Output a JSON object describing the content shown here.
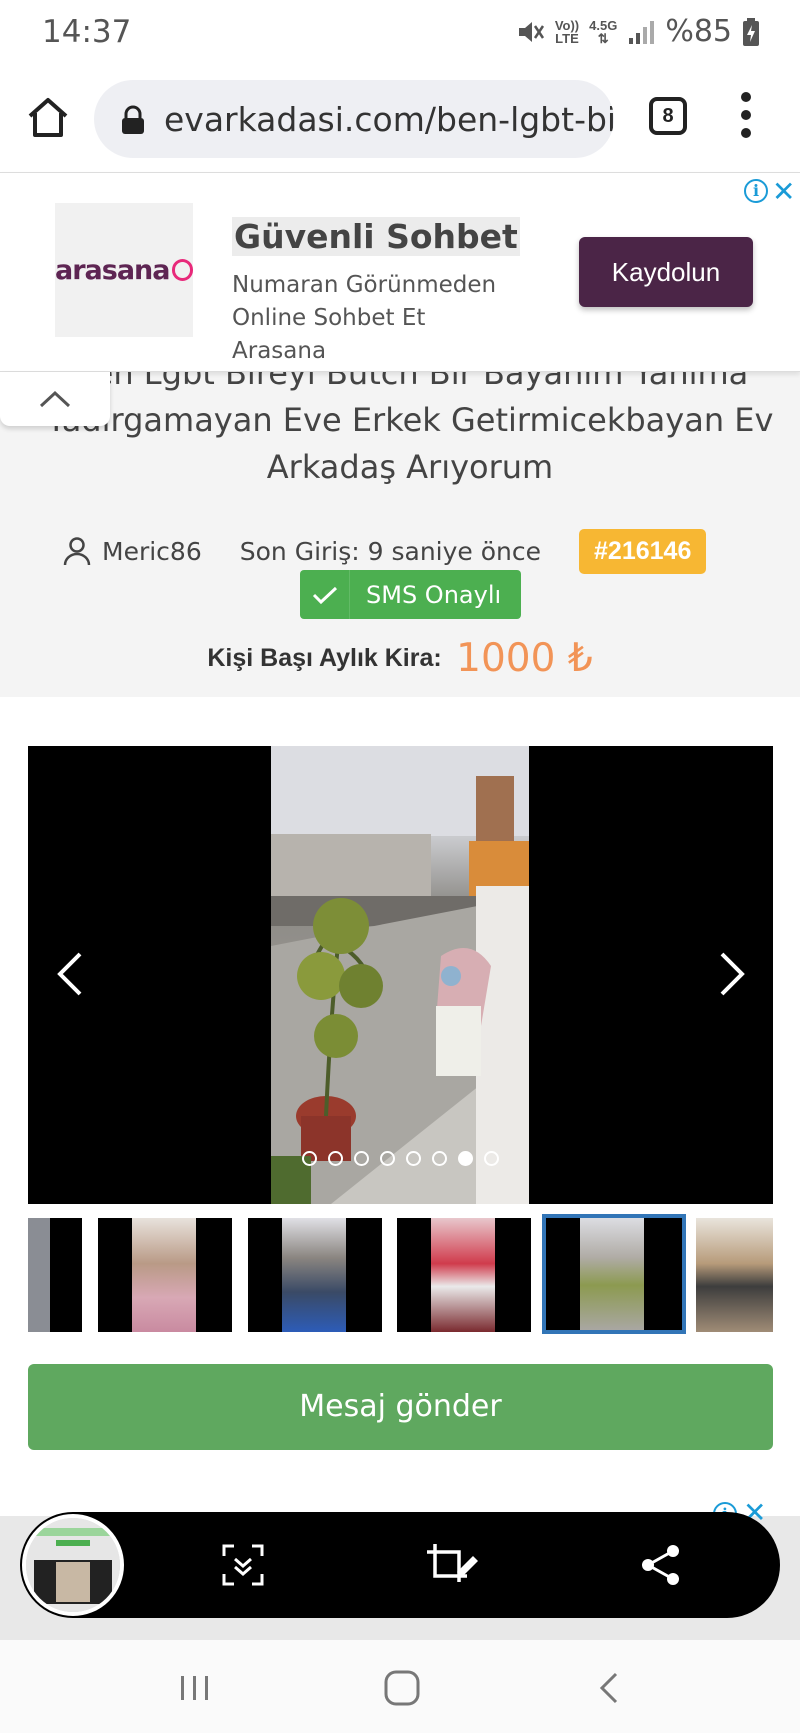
{
  "status_bar": {
    "time": "14:37",
    "network_top": "Vo))",
    "network_bottom": "LTE",
    "data_top": "4.5G",
    "battery": "%85"
  },
  "browser": {
    "url": "evarkadasi.com/ben-lgbt-bireyi-butch",
    "tab_count": "8",
    "icons": [
      "home-icon",
      "lock-icon",
      "tabs-icon",
      "more-vert-icon"
    ]
  },
  "ad": {
    "logo_text": "arasana",
    "title": "Güvenli Sohbet",
    "description": "Numaran Görünmeden Online Sohbet Et Arasana",
    "cta": "Kaydolun",
    "info_glyph": "i",
    "close_glyph": "✕"
  },
  "listing": {
    "title": "Ben Lgbt Bireyi Butch Bir Bayanım Yanıma Yadırgamayan Eve Erkek Getirmicekbayan Ev Arkadaş Arıyorum",
    "username": "Meric86",
    "last_login": "Son Giriş: 9 saniye önce",
    "listing_id": "#216146",
    "sms_badge": "SMS Onaylı",
    "rent_label": "Kişi Başı Aylık Kira:",
    "rent_value": "1000 ₺"
  },
  "gallery": {
    "total_slides": 8,
    "active_slide": 7,
    "thumbnail_count": 6,
    "selected_thumbnail": 5
  },
  "actions": {
    "message_button": "Mesaj gönder"
  },
  "screenshot_toolbar": {
    "icons": [
      "scroll-capture-icon",
      "crop-edit-icon",
      "share-icon"
    ]
  },
  "nav_bar": {
    "icons": [
      "recents-icon",
      "home-nav-icon",
      "back-icon"
    ]
  },
  "colors": {
    "ad_cta": "#4b2547",
    "listing_id_badge": "#f7b733",
    "sms_badge": "#4caf50",
    "rent_value": "#f29457",
    "message_button": "#5fa85f",
    "selected_thumb_border": "#3275b7"
  }
}
